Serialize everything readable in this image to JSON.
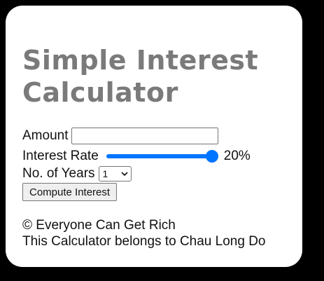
{
  "calculator": {
    "title": "Simple Interest Calculator",
    "amount_label": "Amount",
    "amount_value": "",
    "rate_label": "Interest Rate",
    "rate_value": 20,
    "rate_display": "20%",
    "years_label": "No. of Years",
    "years_selected": "1",
    "compute_button_label": "Compute Interest"
  },
  "footer": {
    "copyright": "© Everyone Can Get Rich",
    "owner": "This Calculator belongs to Chau Long Do"
  },
  "colors": {
    "title": "#7a7a7a",
    "slider_accent": "#0075ff",
    "card_background": "#ffffff",
    "page_background": "#000000"
  }
}
